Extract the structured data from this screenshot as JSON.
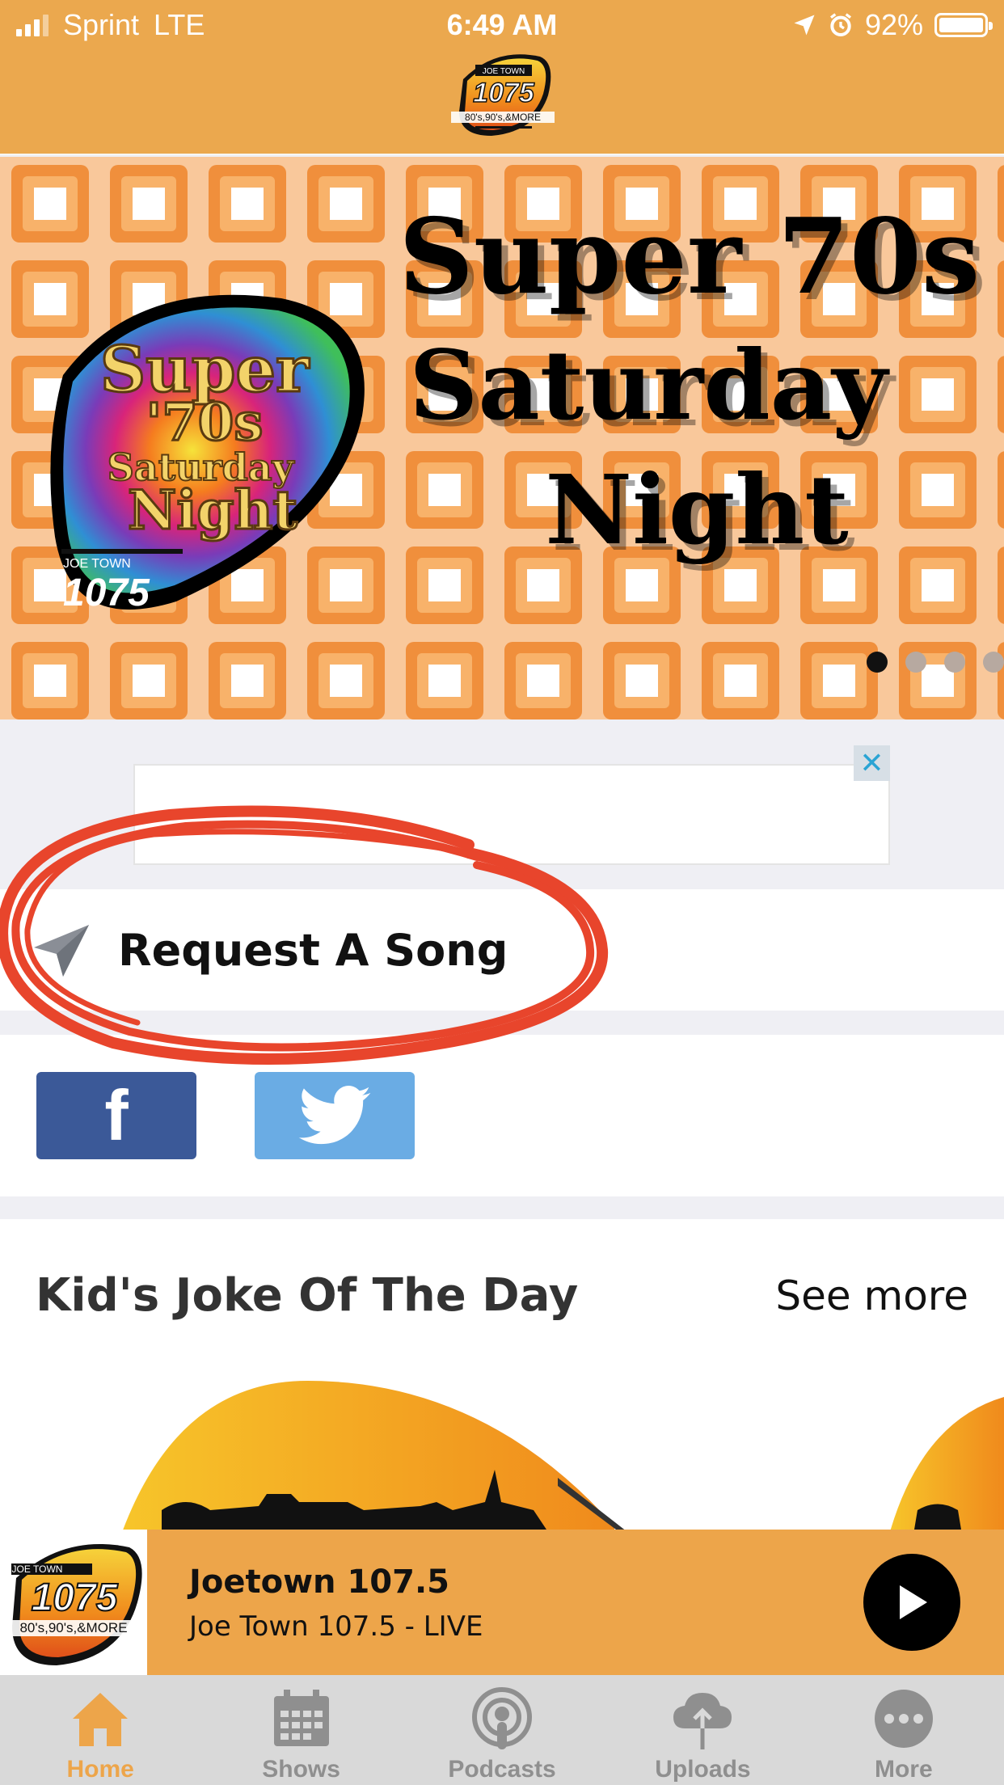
{
  "status_bar": {
    "carrier": "Sprint",
    "network": "LTE",
    "time": "6:49 AM",
    "battery": "92%"
  },
  "header": {
    "logo_icon": "joetown-1075-logo"
  },
  "hero": {
    "title_line1": "Super 70s",
    "title_line2": "Saturday",
    "title_line3": "Night",
    "pick_icon": "super-70s-saturday-night-guitar-pick",
    "carousel_dots": 4,
    "active_dot": 1
  },
  "ad": {
    "close_label": "✕"
  },
  "request": {
    "label": "Request A Song",
    "icon": "paper-plane-icon"
  },
  "social": {
    "facebook_label": "f",
    "twitter_icon": "twitter-bird-icon"
  },
  "joke_section": {
    "title": "Kid's Joke Of The Day",
    "see_more": "See more"
  },
  "player": {
    "station_name": "Joetown 107.5",
    "stream_label": "Joe Town 107.5 - LIVE"
  },
  "tabs": [
    {
      "label": "Home",
      "icon": "home-icon",
      "active": true
    },
    {
      "label": "Shows",
      "icon": "calendar-icon",
      "active": false
    },
    {
      "label": "Podcasts",
      "icon": "podcast-icon",
      "active": false
    },
    {
      "label": "Uploads",
      "icon": "cloud-upload-icon",
      "active": false
    },
    {
      "label": "More",
      "icon": "more-icon",
      "active": false
    }
  ],
  "colors": {
    "accent": "#eda54a",
    "header": "#eba84e",
    "annotation": "#e8452c"
  }
}
